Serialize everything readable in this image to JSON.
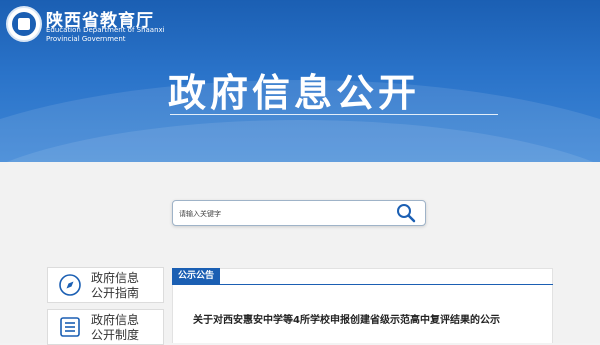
{
  "header": {
    "org_name": "陕西省教育厅",
    "org_name_en": "Education Department of Shaanxi Provincial Government",
    "page_title": "政府信息公开",
    "logo_icon": "education-department-emblem",
    "banner_color": "#1b5fb3"
  },
  "search": {
    "placeholder": "请输入关键字",
    "icon": "magnifier-icon"
  },
  "sidebar": {
    "items": [
      {
        "label_line1": "政府信息",
        "label_line2": "公开指南",
        "icon": "compass-icon"
      },
      {
        "label_line1": "政府信息",
        "label_line2": "公开制度",
        "icon": "document-list-icon"
      }
    ]
  },
  "notices": {
    "tab_label": "公示公告",
    "items": [
      {
        "title": "关于对西安惠安中学等4所学校申报创建省级示范高中复评结果的公示"
      }
    ]
  }
}
